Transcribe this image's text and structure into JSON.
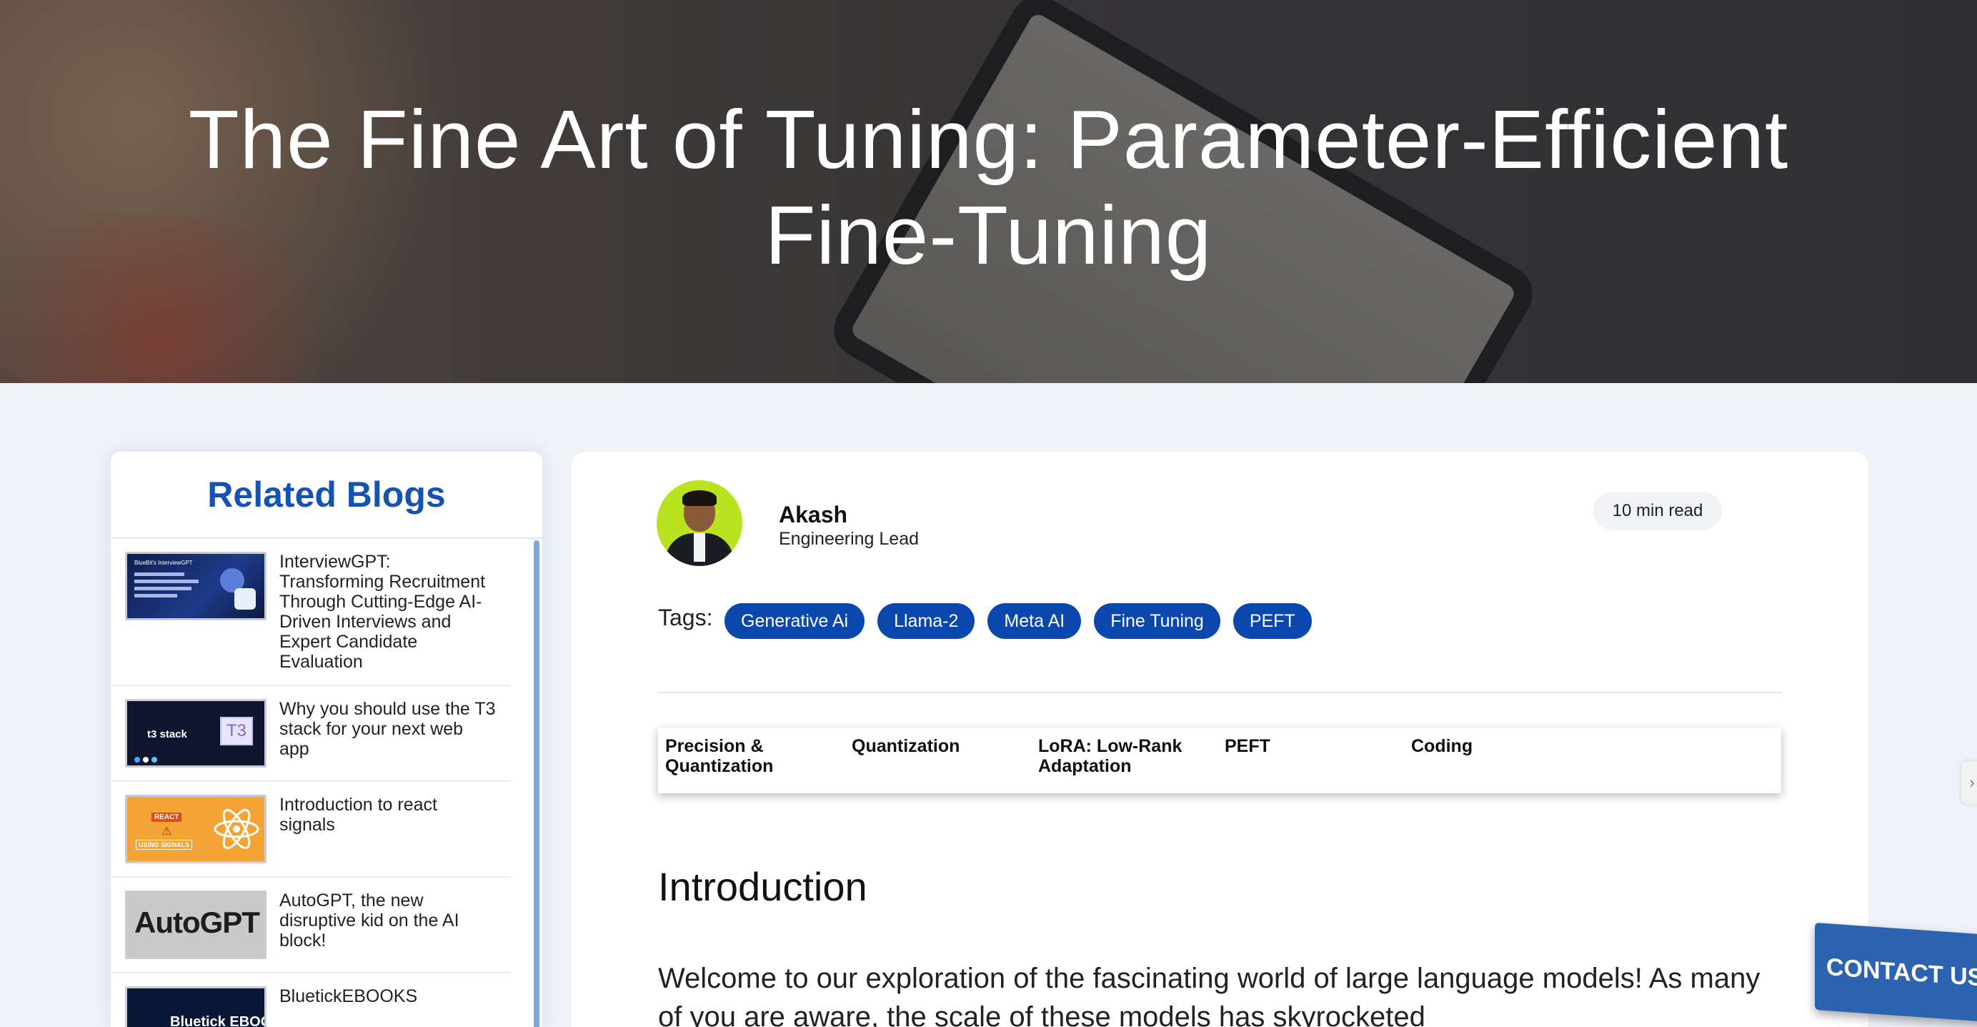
{
  "hero": {
    "title": "The Fine Art of Tuning: Parameter-Efficient Fine-Tuning"
  },
  "sidebar": {
    "title": "Related Blogs",
    "items": [
      {
        "title": "InterviewGPT: Transforming Recruitment Through Cutting-Edge AI-Driven Interviews and Expert Candidate Evaluation",
        "thumb_text": "BlueBit's InterviewGPT"
      },
      {
        "title": "Why you should use the T3 stack for your next web app",
        "thumb_text": "t3 stack",
        "thumb_logo": "T3"
      },
      {
        "title": "Introduction to react signals",
        "thumb_text": "REACT",
        "thumb_sub": "USING SIGNALS"
      },
      {
        "title": "AutoGPT, the new disruptive kid on the AI block!",
        "thumb_text": "AutoGPT"
      },
      {
        "title": "BluetickEBOOKS",
        "thumb_text": "Bluetick EBOOK"
      }
    ]
  },
  "author": {
    "name": "Akash",
    "role": "Engineering Lead"
  },
  "read_time": "10 min read",
  "tags": {
    "label": "Tags:",
    "items": [
      "Generative Ai",
      "Llama-2",
      "Meta AI",
      "Fine Tuning",
      "PEFT"
    ]
  },
  "toc": {
    "items": [
      "Precision & Quantization",
      "Quantization",
      "LoRA: Low-Rank Adaptation",
      "PEFT",
      "Coding"
    ]
  },
  "article": {
    "heading": "Introduction",
    "paragraph": " Welcome to our exploration of the fascinating world of large language models! As many of you are aware, the scale of these models has skyrocketed"
  },
  "overlay": {
    "contact_label": "CONTACT US",
    "side_tab_icon": "chevron-right-icon"
  },
  "colors": {
    "accent": "#1453b4",
    "tag_bg": "#0b48ad",
    "page_bg": "#eff3f7"
  }
}
